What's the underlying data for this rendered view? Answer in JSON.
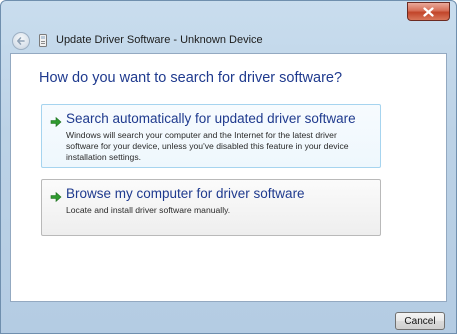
{
  "window": {
    "title": "Update Driver Software - Unknown Device"
  },
  "content": {
    "heading": "How do you want to search for driver software?",
    "options": [
      {
        "title": "Search automatically for updated driver software",
        "description": "Windows will search your computer and the Internet for the latest driver software for your device, unless you've disabled this feature in your device installation settings."
      },
      {
        "title": "Browse my computer for driver software",
        "description": "Locate and install driver software manually."
      }
    ]
  },
  "footer": {
    "cancel_label": "Cancel"
  },
  "icons": {
    "close": "close-icon",
    "back": "back-arrow-icon",
    "device": "device-icon",
    "option_arrow": "green-arrow-icon"
  },
  "colors": {
    "heading": "#1f3a8e",
    "option_highlight_border": "#a6d4ef",
    "arrow_green": "#2f9a2f",
    "close_red": "#c2452a"
  }
}
